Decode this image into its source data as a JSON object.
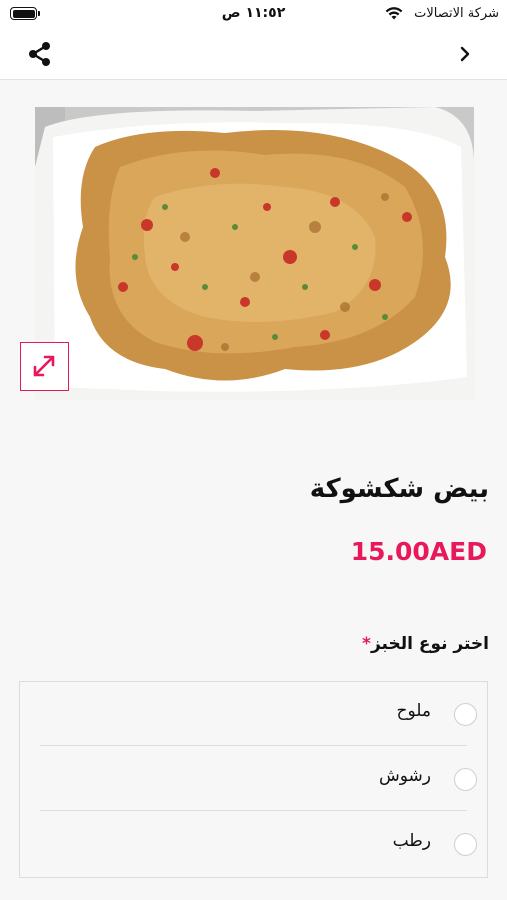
{
  "status_bar": {
    "time": "١١:٥٢ ص",
    "carrier": "شركة الاتصالات",
    "icons": [
      "battery-icon",
      "wifi-icon"
    ]
  },
  "nav": {
    "icons": [
      "share-icon",
      "chevron-right-icon"
    ]
  },
  "product": {
    "image_icon": "food-photo",
    "title": "بيض شكشوكة",
    "price": "15.00AED",
    "expand_icon": "expand-arrows-icon"
  },
  "option_group": {
    "title": "اختر نوع الخبز",
    "required_mark": "*",
    "options": [
      {
        "label": "ملوح",
        "selected": false
      },
      {
        "label": "رشوش",
        "selected": false
      },
      {
        "label": "رطب",
        "selected": false
      }
    ]
  },
  "colors": {
    "accent": "#e8195a",
    "background": "#f7f7f7",
    "header_bg": "#ffffff"
  }
}
